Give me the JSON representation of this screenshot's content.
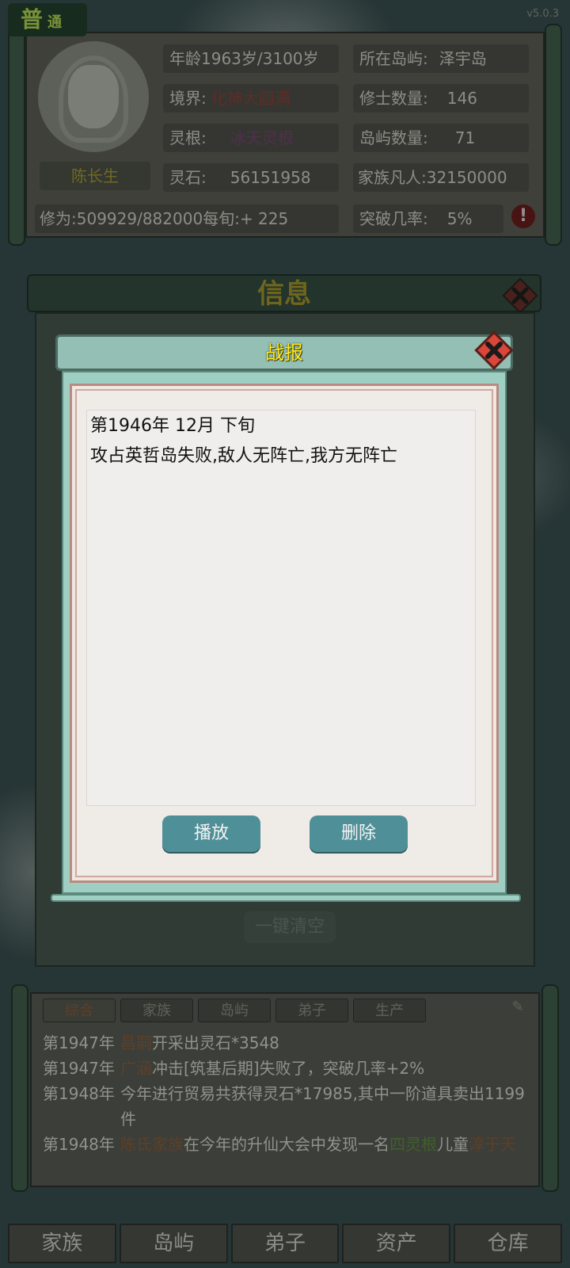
{
  "game": {
    "mode_label": "普",
    "mode_sub": "通",
    "version": "v5.0.3"
  },
  "status": {
    "character_name": "陈长生",
    "age_label": "年龄",
    "age_value": "1963岁/3100岁",
    "realm_label": "境界:",
    "realm_value": "化神大圆满",
    "root_label": "灵根:",
    "root_value": "冰天灵根",
    "stone_label": "灵石:",
    "stone_value": "56151958",
    "cultivation_label": "修为:",
    "cultivation_value": "509929/882000",
    "per_period_label": "每旬:",
    "per_period_value": "+ 225",
    "island_label": "所在岛屿:",
    "island_value": "泽宇岛",
    "cultivators_label": "修士数量:",
    "cultivators_value": "146",
    "islands_label": "岛屿数量:",
    "islands_value": "71",
    "mortals_label": "家族凡人:",
    "mortals_value": "32150000",
    "breakthrough_label": "突破几率:",
    "breakthrough_value": "5%",
    "warning_glyph": "!"
  },
  "info_panel": {
    "title": "信息",
    "clear_label": "一键清空"
  },
  "dialog": {
    "title": "战报",
    "report_date": "第1946年 12月 下旬",
    "report_text": "攻占英哲岛失败,敌人无阵亡,我方无阵亡",
    "play_label": "播放",
    "delete_label": "删除"
  },
  "log": {
    "tabs": [
      "综合",
      "家族",
      "岛屿",
      "弟子",
      "生产"
    ],
    "active_tab": 0,
    "entries": [
      {
        "year": "第1947年",
        "segments": [
          {
            "t": "昌嗣",
            "c": "brown"
          },
          {
            "t": "开采出灵石*3548",
            "c": ""
          }
        ]
      },
      {
        "year": "第1947年",
        "segments": [
          {
            "t": "广涵",
            "c": "brown"
          },
          {
            "t": "冲击[筑基后期]失败了，突破几率+2%",
            "c": ""
          }
        ]
      },
      {
        "year": "第1948年",
        "segments": [
          {
            "t": "今年进行贸易共获得灵石*17985,其中一阶道具卖出1199件",
            "c": ""
          }
        ]
      },
      {
        "year": "第1948年",
        "segments": [
          {
            "t": "陈氏家族",
            "c": "brown"
          },
          {
            "t": "在今年的升仙大会中发现一名",
            "c": ""
          },
          {
            "t": "四灵根",
            "c": "green"
          },
          {
            "t": "儿童",
            "c": ""
          },
          {
            "t": "淳于天",
            "c": "brown"
          }
        ]
      }
    ]
  },
  "nav": {
    "items": [
      "家族",
      "岛屿",
      "弟子",
      "资产",
      "仓库"
    ]
  },
  "colors": {
    "accent_yellow": "#ffeb1a",
    "button_teal": "#4f8f98",
    "dialog_frame": "#9fcfc2",
    "close_red": "#c0392b"
  }
}
